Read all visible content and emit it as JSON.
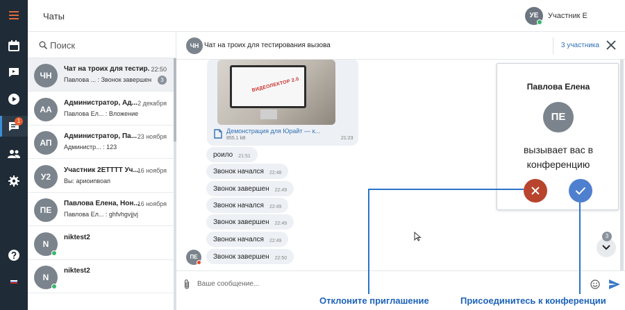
{
  "rail": {
    "menu_icon": "hamburger-icon",
    "items": [
      {
        "name": "calendar",
        "icon": "calendar-icon"
      },
      {
        "name": "video",
        "icon": "video-chat-icon"
      },
      {
        "name": "play",
        "icon": "play-icon"
      },
      {
        "name": "chats",
        "icon": "chat-icon",
        "badge": "1",
        "active": true
      },
      {
        "name": "contacts",
        "icon": "people-icon"
      },
      {
        "name": "settings",
        "icon": "gear-icon"
      },
      {
        "name": "help",
        "icon": "help-icon"
      }
    ],
    "flag_colors": [
      "#ffffff",
      "#2a5bd7",
      "#d52b1e"
    ],
    "accent": "#3b8fd9"
  },
  "header": {
    "title": "Чаты",
    "user_initials": "УЕ",
    "user_name": "Участник Е"
  },
  "search": {
    "placeholder": "Поиск"
  },
  "chats": [
    {
      "initials": "ЧН",
      "name": "Чат на троих для тестир...",
      "time": "22:50",
      "preview": "Павлова ... : Звонок завершен",
      "count": "3",
      "online": false,
      "active": true
    },
    {
      "initials": "АА",
      "name": "Администратор, Ад...",
      "time": "2 декабря",
      "preview": "Павлова Ел... : Вложение",
      "count": "",
      "online": false,
      "active": false
    },
    {
      "initials": "АП",
      "name": "Администратор, Па...",
      "time": "23 ноября",
      "preview": "Администр... : 123",
      "count": "",
      "online": false,
      "active": false
    },
    {
      "initials": "У2",
      "name": "Участник 2ЕТТТТ Уч...",
      "time": "16 ноября",
      "preview": "Вы: ариоипвоап",
      "count": "",
      "online": false,
      "active": false
    },
    {
      "initials": "ПЕ",
      "name": "Павлова Елена, Нон...",
      "time": "16 ноября",
      "preview": "Павлова Ел... : ghfvhgvjjvj",
      "count": "",
      "online": false,
      "active": false
    },
    {
      "initials": "N",
      "name": "niktest2",
      "time": "",
      "preview": "",
      "count": "",
      "online": true,
      "active": false
    },
    {
      "initials": "N",
      "name": "niktest2",
      "time": "",
      "preview": "",
      "count": "",
      "online": true,
      "active": false
    }
  ],
  "conversation": {
    "initials": "ЧН",
    "title": "Чат на троих для тестирования вызова",
    "participants": "3 участника",
    "close_icon": "close-icon",
    "file": {
      "logo_text": "ВИДЕОЛЕКТОР 2.0",
      "name": "Демонстрация для Юрайт — к...",
      "size": "855.1 kB",
      "time": "21:23",
      "icon": "file-icon"
    },
    "messages": [
      {
        "text": "роило",
        "time": "21:51"
      },
      {
        "text": "Звонок начался",
        "time": "22:48"
      },
      {
        "text": "Звонок завершен",
        "time": "22:49"
      },
      {
        "text": "Звонок начался",
        "time": "22:49"
      },
      {
        "text": "Звонок завершен",
        "time": "22:49"
      },
      {
        "text": "Звонок начался",
        "time": "22:49"
      },
      {
        "text": "Звонок завершен",
        "time": "22:50"
      }
    ],
    "sender_initials": "ПЕ",
    "unread_count": "3"
  },
  "composer": {
    "placeholder": "Ваше сообщение...",
    "attach_icon": "paperclip-icon",
    "emoji_icon": "smiley-icon",
    "send_icon": "send-icon"
  },
  "call": {
    "caller": "Павлова Елена",
    "initials": "ПЕ",
    "message": "вызывает вас в конференцию",
    "decline_color": "#b8442e",
    "accept_color": "#4f80cf"
  },
  "annotations": {
    "decline": "Отклоните приглашение",
    "accept": "Присоединитесь к конференции"
  }
}
